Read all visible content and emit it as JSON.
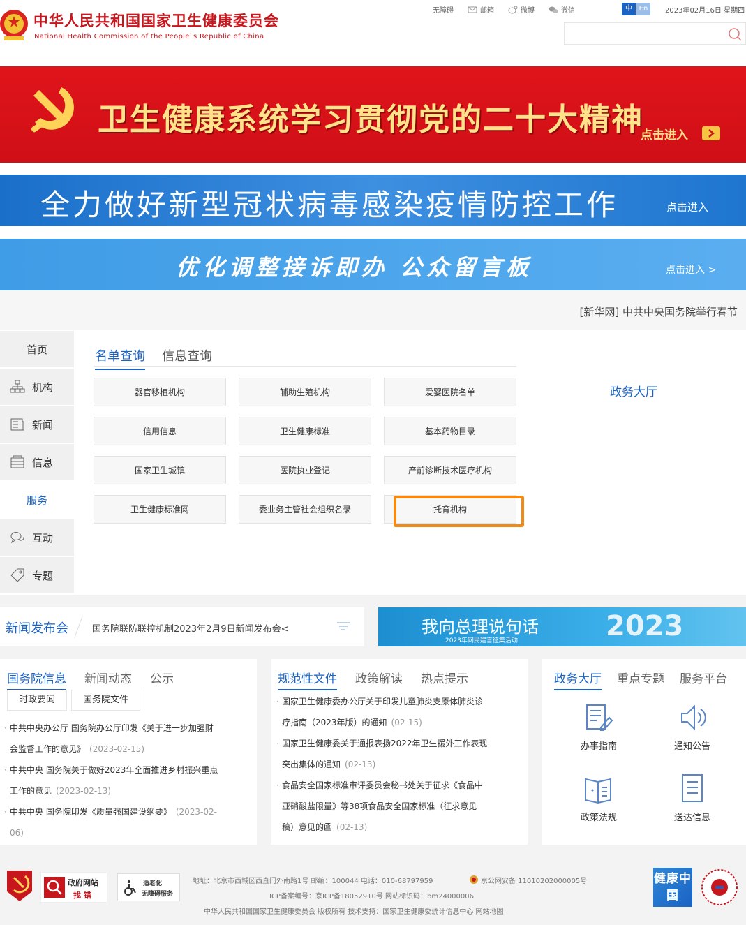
{
  "header": {
    "title_cn": "中华人民共和国国家卫生健康委员会",
    "title_en": "National Health Commission of the People`s Republic of China",
    "toplinks": [
      "无障碍",
      "邮箱",
      "微博",
      "微信"
    ],
    "lang_zh": "中",
    "lang_en": "En",
    "date": "2023年02月16日 星期四"
  },
  "banners": {
    "party": "卫生健康系统学习贯彻党的二十大精神",
    "party_enter": "点击进入",
    "covid": "全力做好新型冠状病毒感染疫情防控工作",
    "covid_enter": "点击进入",
    "board": "优化调整接诉即办   公众留言板",
    "board_enter": "点击进入 >",
    "ticker": "[新华网] 中共中央国务院举行春节"
  },
  "side_nav": [
    "首页",
    "机构",
    "新闻",
    "信息",
    "服务",
    "互动",
    "专题"
  ],
  "service": {
    "tabs": [
      "名单查询",
      "信息查询"
    ],
    "buttons": [
      "器官移植机构",
      "辅助生殖机构",
      "爱婴医院名单",
      "信用信息",
      "卫生健康标准",
      "基本药物目录",
      "国家卫生城镇",
      "医院执业登记",
      "产前诊断技术医疗机构",
      "卫生健康标准网",
      "委业务主管社会组织名录",
      "托育机构"
    ],
    "hall_link": "政务大厅"
  },
  "conference": {
    "title": "新闻发布会",
    "text": "国务院联防联控机制2023年2月9日新闻发布会<"
  },
  "premier_banner": {
    "text": "我向总理说句话",
    "sub": "2023年网民建言征集活动",
    "year": "2023"
  },
  "col1": {
    "tabs": [
      "国务院信息",
      "新闻动态",
      "公示"
    ],
    "subtabs": [
      "时政要闻",
      "国务院文件"
    ],
    "items": [
      {
        "text": "中共中央办公厅 国务院办公厅印发《关于进一步加强财",
        "cont": "会监督工作的意见》",
        "date": "(2023-02-15)"
      },
      {
        "text": "中共中央 国务院关于做好2023年全面推进乡村振兴重点",
        "cont": "工作的意见",
        "date": "(2023-02-13)"
      },
      {
        "text": "中共中央 国务院印发《质量强国建设纲要》",
        "cont": "",
        "date": "(2023-02-",
        "date2": "06)"
      }
    ]
  },
  "col2": {
    "tabs": [
      "规范性文件",
      "政策解读",
      "热点提示"
    ],
    "items": [
      {
        "text": "国家卫生健康委办公厅关于印发儿童肺炎支原体肺炎诊",
        "cont": "疗指南（2023年版）的通知",
        "date": "(02-15)"
      },
      {
        "text": "国家卫生健康委关于通报表扬2022年卫生援外工作表现",
        "cont": "突出集体的通知",
        "date": "(02-13)"
      },
      {
        "text": "食品安全国家标准审评委员会秘书处关于征求《食品中",
        "cont": "亚硝酸盐限量》等38项食品安全国家标准（征求意见",
        "cont2": "稿）意见的函",
        "date": "(02-13)"
      }
    ]
  },
  "col3": {
    "tabs": [
      "政务大厅",
      "重点专题",
      "服务平台"
    ],
    "services": [
      "办事指南",
      "通知公告",
      "政策法规",
      "送达信息"
    ]
  },
  "footer": {
    "gov_site": "政府网站",
    "find_error": "找 错",
    "aged_service": "适老化",
    "barrier_free": "无障碍服务",
    "line1": "地址：北京市西城区西直门外南路1号   邮编：100044   电话：010-68797959",
    "police": "京公网安备 11010202000005号",
    "line2": "ICP备案编号：京ICP备18052910号    网站标识码：bm24000006",
    "line3": "中华人民共和国国家卫生健康委员会   版权所有   技术支持：国家卫生健康委统计信息中心   网站地图",
    "health_logo": "健康中国"
  },
  "colors": {
    "brand_red": "#c8161d",
    "banner_red": "#d8121a",
    "link_blue": "#1a63c4",
    "highlight": "#f28a16"
  }
}
